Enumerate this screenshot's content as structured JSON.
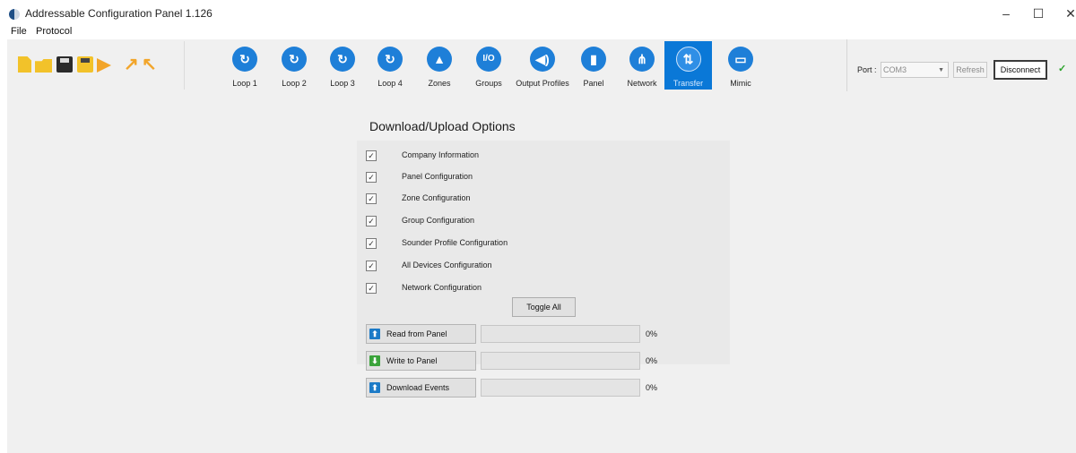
{
  "window": {
    "title": "Addressable Configuration Panel 1.126",
    "min_label": "–",
    "max_label": "☐",
    "close_label": "✕"
  },
  "menu": {
    "items": [
      "File",
      "Protocol"
    ]
  },
  "toolbar": {
    "nav": [
      {
        "label": "Loop 1",
        "glyph": "↻",
        "icon": "loop-icon"
      },
      {
        "label": "Loop 2",
        "glyph": "↻",
        "icon": "loop-icon"
      },
      {
        "label": "Loop 3",
        "glyph": "↻",
        "icon": "loop-icon"
      },
      {
        "label": "Loop 4",
        "glyph": "↻",
        "icon": "loop-icon"
      },
      {
        "label": "Zones",
        "glyph": "▲",
        "icon": "zones-icon"
      },
      {
        "label": "Groups",
        "glyph": "I/O",
        "icon": "groups-icon"
      },
      {
        "label": "Output Profiles",
        "glyph": "◀)",
        "icon": "speaker-icon"
      },
      {
        "label": "Panel",
        "glyph": "▮",
        "icon": "panel-icon"
      },
      {
        "label": "Network",
        "glyph": "⋔",
        "icon": "network-icon"
      },
      {
        "label": "Transfer",
        "glyph": "⇅",
        "icon": "transfer-icon"
      },
      {
        "label": "Mimic",
        "glyph": "▭",
        "icon": "mimic-icon"
      }
    ],
    "active": "Transfer",
    "accent_color": "#0a78d7"
  },
  "port": {
    "label": "Port :",
    "value": "COM3",
    "refresh_label": "Refresh",
    "disconnect_label": "Disconnect",
    "status_glyph": "✓",
    "status_color": "#2aa32a"
  },
  "options": {
    "title": "Download/Upload Options",
    "items": [
      {
        "label": "Company Information",
        "checked": true
      },
      {
        "label": "Panel Configuration",
        "checked": true
      },
      {
        "label": "Zone Configuration",
        "checked": true
      },
      {
        "label": "Group Configuration",
        "checked": true
      },
      {
        "label": "Sounder Profile Configuration",
        "checked": true
      },
      {
        "label": "All Devices Configuration",
        "checked": true
      },
      {
        "label": "Network Configuration",
        "checked": true
      }
    ],
    "toggle_label": "Toggle All"
  },
  "actions": [
    {
      "label": "Read from Panel",
      "icon": "upload-icon",
      "icon_color": "blue",
      "progress": 0,
      "percent_text": "0%"
    },
    {
      "label": "Write to Panel",
      "icon": "download-icon",
      "icon_color": "green",
      "progress": 0,
      "percent_text": "0%"
    },
    {
      "label": "Download Events",
      "icon": "upload-icon",
      "icon_color": "blue",
      "progress": 0,
      "percent_text": "0%"
    }
  ]
}
